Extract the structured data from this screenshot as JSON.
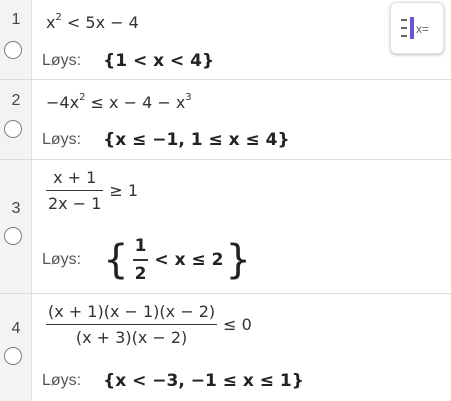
{
  "rows": [
    {
      "number": "1",
      "input": {
        "a": "x",
        "sup": "2",
        "b": " < 5x − 4"
      },
      "label": "Løys:",
      "result": "{1 < x < 4}"
    },
    {
      "number": "2",
      "input": {
        "a": "−4x",
        "sup": "2",
        "b": " ≤ x − 4 − x",
        "sup2": "3"
      },
      "label": "Løys:",
      "result": "{x ≤ −1, 1 ≤ x ≤ 4}"
    },
    {
      "number": "3",
      "input": {
        "num": "x + 1",
        "den": "2x − 1",
        "rel": "≥ 1"
      },
      "label": "Løys:",
      "result": {
        "open": "{",
        "num": "1",
        "den": "2",
        "rest": "< x ≤ 2",
        "close": "}"
      }
    },
    {
      "number": "4",
      "input": {
        "num": "(x + 1)(x − 1)(x − 2)",
        "den": "(x + 3)(x − 2)",
        "rel": "≤ 0"
      },
      "label": "Løys:",
      "result": "{x < −3, −1 ≤ x ≤ 1}"
    }
  ],
  "toolbar": {
    "algebra_icon_text": "x="
  },
  "colors": {
    "accent": "#6557d2",
    "gutter": "#f3f3f3",
    "divider": "#dcdcdc"
  }
}
